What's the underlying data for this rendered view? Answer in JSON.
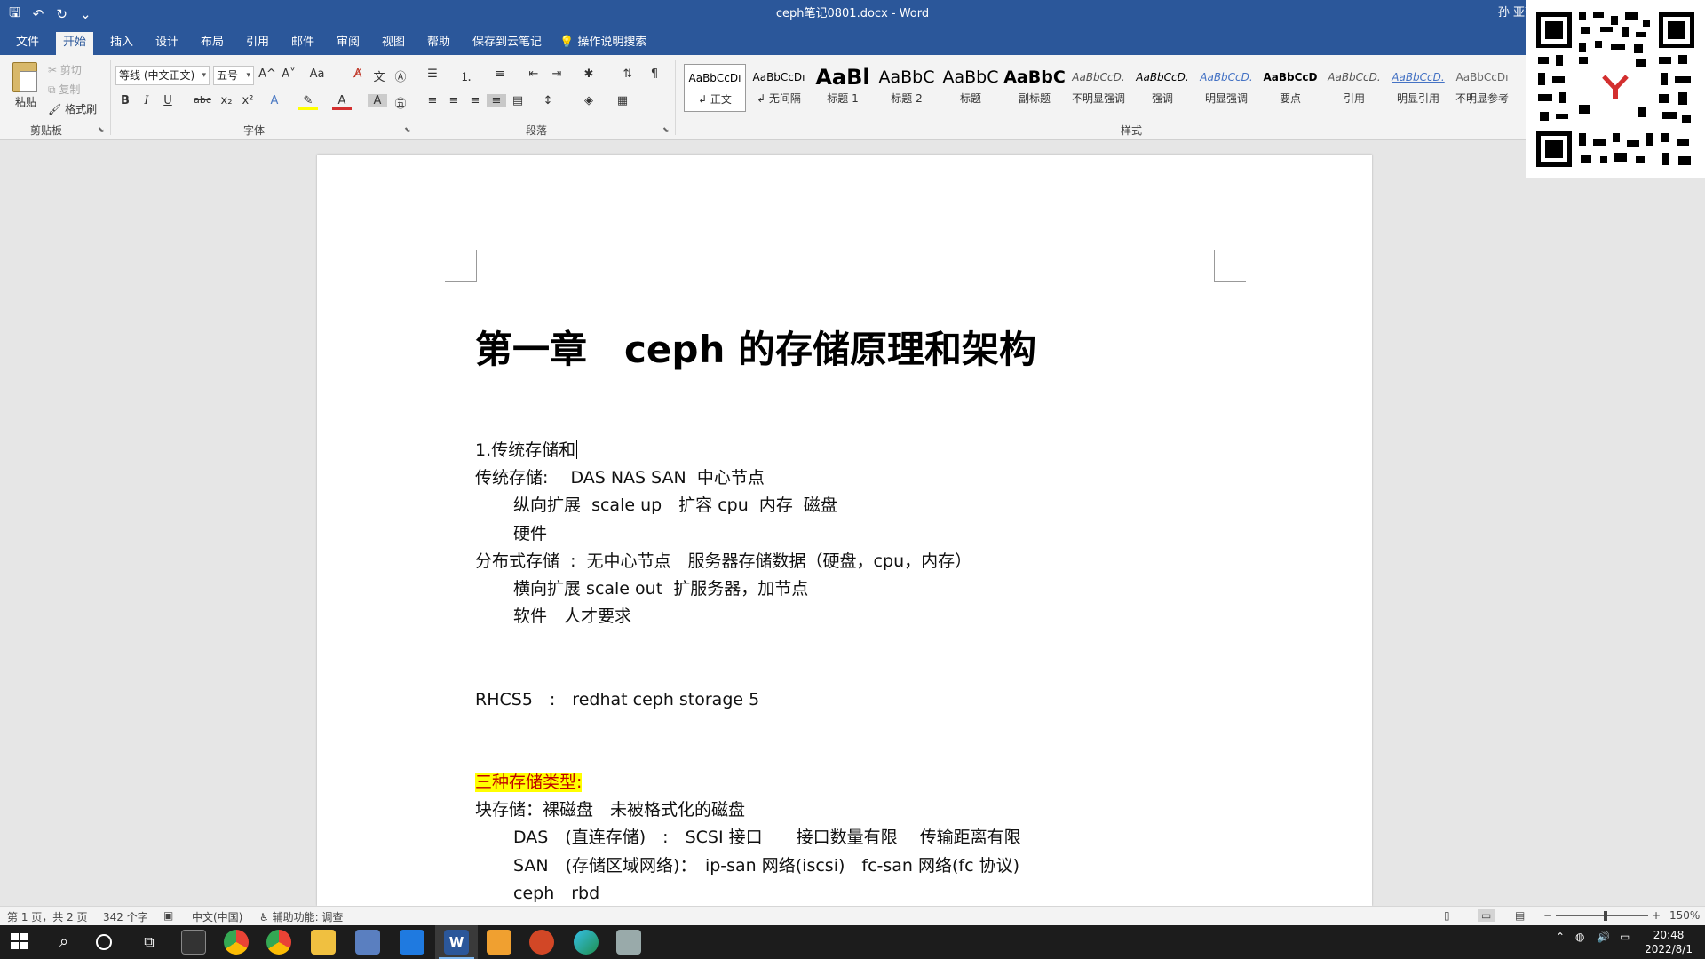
{
  "window": {
    "title": "ceph笔记0801.docx  -  Word",
    "user": "孙 亚萍"
  },
  "qat": {
    "save": "🖫",
    "undo": "↶",
    "redo": "↻",
    "customize": "⌄"
  },
  "tabs": [
    "文件",
    "开始",
    "插入",
    "设计",
    "布局",
    "引用",
    "邮件",
    "审阅",
    "视图",
    "帮助",
    "保存到云笔记"
  ],
  "tell_me": "操作说明搜索",
  "ribbon": {
    "clipboard": {
      "label": "剪贴板",
      "paste": "粘贴",
      "cut": "剪切",
      "copy": "复制",
      "format_painter": "格式刷"
    },
    "font": {
      "label": "字体",
      "font_name": "等线 (中文正文)",
      "font_size": "五号",
      "bold": "B",
      "italic": "I",
      "underline": "U",
      "strike": "abc",
      "sub": "x₂",
      "sup": "x²",
      "grow": "A^",
      "shrink": "A˅",
      "case": "Aa"
    },
    "paragraph": {
      "label": "段落"
    },
    "styles": {
      "label": "样式",
      "items": [
        {
          "sample": "AaBbCcDı",
          "name": "↲ 正文"
        },
        {
          "sample": "AaBbCcDı",
          "name": "↲ 无间隔"
        },
        {
          "sample": "AaBl",
          "name": "标题 1"
        },
        {
          "sample": "AaBbC",
          "name": "标题 2"
        },
        {
          "sample": "AaBbC",
          "name": "标题"
        },
        {
          "sample": "AaBbC",
          "name": "副标题"
        },
        {
          "sample": "AaBbCcD.",
          "name": "不明显强调"
        },
        {
          "sample": "AaBbCcD.",
          "name": "强调"
        },
        {
          "sample": "AaBbCcD.",
          "name": "明显强调"
        },
        {
          "sample": "AaBbCcD",
          "name": "要点"
        },
        {
          "sample": "AaBbCcD.",
          "name": "引用"
        },
        {
          "sample": "AaBbCcD.",
          "name": "明显引用"
        },
        {
          "sample": "AaBbCcDı",
          "name": "不明显参考"
        }
      ]
    }
  },
  "document": {
    "heading": "第一章　ceph 的存储原理和架构",
    "lines": [
      "1.传统存储和",
      "传统存储:　 DAS NAS SAN  中心节点",
      "纵向扩展  scale up　扩容 cpu  内存  磁盘",
      "硬件",
      "分布式存储  :  无中心节点　服务器存储数据（硬盘，cpu，内存）",
      "横向扩展 scale out  扩服务器，加节点",
      "软件　人才要求",
      "RHCS5　:　redhat ceph storage 5",
      "三种存储类型:",
      "块存储：裸磁盘　未被格式化的磁盘",
      "DAS　(直连存储)　:　SCSI 接口　　接口数量有限　 传输距离有限",
      "SAN　(存储区域网络)：　ip-san 网络(iscsi)　fc-san 网络(fc 协议)",
      "ceph　rbd"
    ]
  },
  "status": {
    "page": "第 1 页，共 2 页",
    "words": "342 个字",
    "language": "中文(中国)",
    "accessibility": "辅助功能: 调查",
    "zoom": "150%"
  },
  "taskbar": {
    "time": "20:48",
    "date": "2022/8/1"
  }
}
